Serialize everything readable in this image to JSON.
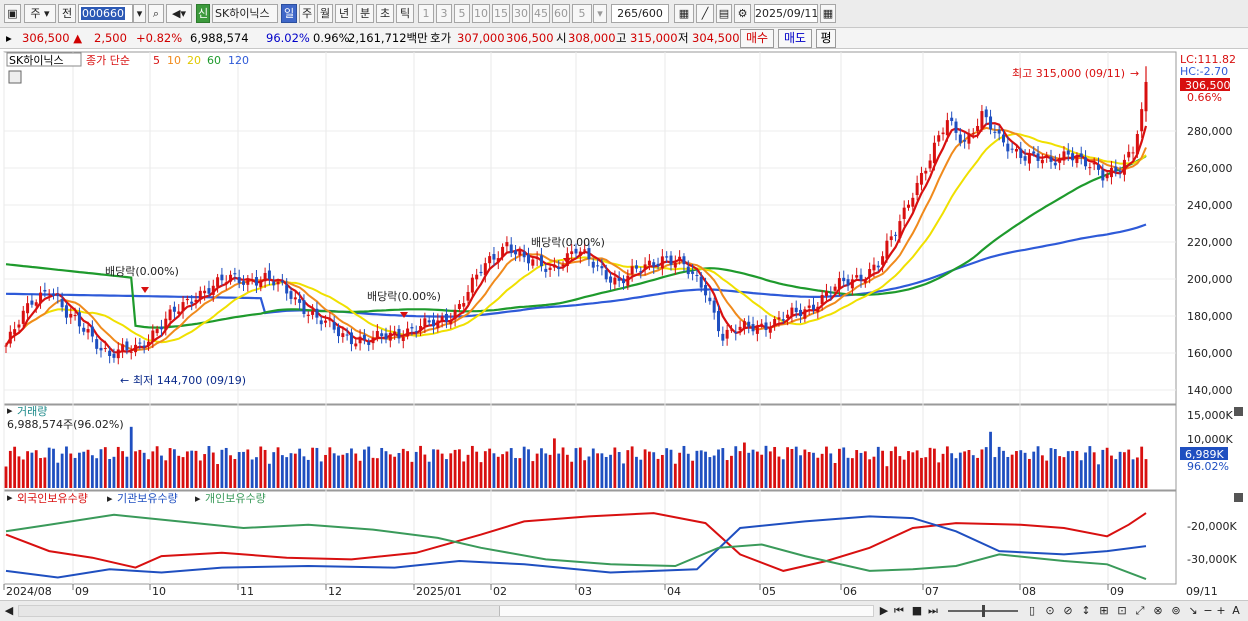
{
  "toolbar": {
    "market": "주",
    "prev": "전",
    "code": "000660",
    "name": "SK하이닉스",
    "credit": "신",
    "periods": [
      "일",
      "주",
      "월",
      "년",
      "분",
      "초",
      "틱"
    ],
    "active_period": "일",
    "intervals": [
      "1",
      "3",
      "5",
      "10",
      "15",
      "30",
      "45",
      "60"
    ],
    "interval_input": "5",
    "count": "265",
    "count_max": "/600",
    "date": "2025/09/11"
  },
  "info": {
    "price": "306,500",
    "arrow": "▲",
    "change": "2,500",
    "change_pct": "+0.82%",
    "volume": "6,988,574",
    "volume_ratio": "96.02%",
    "turnover_pct": "0.96%",
    "amount": "2,161,712백만",
    "ask_label": "호가",
    "ask": "307,000",
    "bid": "306,500",
    "open_label": "시",
    "open": "308,000",
    "high_label": "고",
    "high": "315,000",
    "low_label": "저",
    "low": "304,500",
    "buy": "매수",
    "sell": "매도",
    "eval": "평"
  },
  "price_panel": {
    "title": "SK하이닉스",
    "ma_label": "종가 단순",
    "ma_periods": [
      "5",
      "10",
      "20",
      "60",
      "120"
    ],
    "lc": "LC:111.82",
    "hc": "HC:-2.70",
    "cur_price": "306,500",
    "cur_pct": "0.66%",
    "high_note": "최고 315,000 (09/11)",
    "low_note": "최저 144,700 (09/19)",
    "dividend": [
      "배당락(0.00%)",
      "배당락(0.00%)",
      "배당락(0.00%)"
    ],
    "y_ticks": [
      "280,000",
      "260,000",
      "240,000",
      "220,000",
      "200,000",
      "180,000",
      "160,000",
      "140,000"
    ]
  },
  "volume_panel": {
    "title": "거래량",
    "current": "6,988,574주(96.02%)",
    "y_ticks": [
      "15,000K",
      "10,000K",
      "5,000K"
    ],
    "cur_value": "6,989K",
    "cur_pct": "96.02%"
  },
  "holdings_panel": {
    "series": [
      "외국인보유수량",
      "기관보유수량",
      "개인보유수량"
    ],
    "y_ticks": [
      "-20,000K",
      "-30,000K"
    ]
  },
  "x_axis": {
    "labels": [
      "2024/08",
      "09",
      "10",
      "11",
      "12",
      "2025/01",
      "02",
      "03",
      "04",
      "05",
      "06",
      "07",
      "08",
      "09"
    ],
    "end": "09/11"
  },
  "colors": {
    "ma5": "#d81010",
    "ma10": "#f08a1c",
    "ma20": "#f0e000",
    "ma60": "#1e9a2c",
    "ma120": "#2e5ad8",
    "up": "#d81010",
    "down": "#1f4fc0",
    "foreign": "#d81010",
    "institution": "#1f4fc0",
    "individual": "#3a9a5a"
  },
  "chart_data": {
    "type": "candlestick",
    "title": "SK하이닉스",
    "x_range": [
      "2024/08",
      "2025/09/11"
    ],
    "ylim": [
      135000,
      320000
    ],
    "overlays": [
      "MA5",
      "MA10",
      "MA20",
      "MA60",
      "MA120"
    ],
    "monthly_close": [
      {
        "x": "2024/08",
        "value": 172000
      },
      {
        "x": "09",
        "value": 160000
      },
      {
        "x": "10",
        "value": 193000
      },
      {
        "x": "11",
        "value": 178000
      },
      {
        "x": "12",
        "value": 168000
      },
      {
        "x": "2025/01",
        "value": 205000
      },
      {
        "x": "02",
        "value": 202000
      },
      {
        "x": "03",
        "value": 190000
      },
      {
        "x": "04",
        "value": 178000
      },
      {
        "x": "05",
        "value": 205000
      },
      {
        "x": "06",
        "value": 268000
      },
      {
        "x": "07",
        "value": 270000
      },
      {
        "x": "08",
        "value": 258000
      },
      {
        "x": "09/11",
        "value": 306500
      }
    ],
    "high": {
      "label": "최고",
      "value": 315000,
      "date": "09/11"
    },
    "low": {
      "label": "최저",
      "value": 144700,
      "date": "09/19"
    }
  }
}
